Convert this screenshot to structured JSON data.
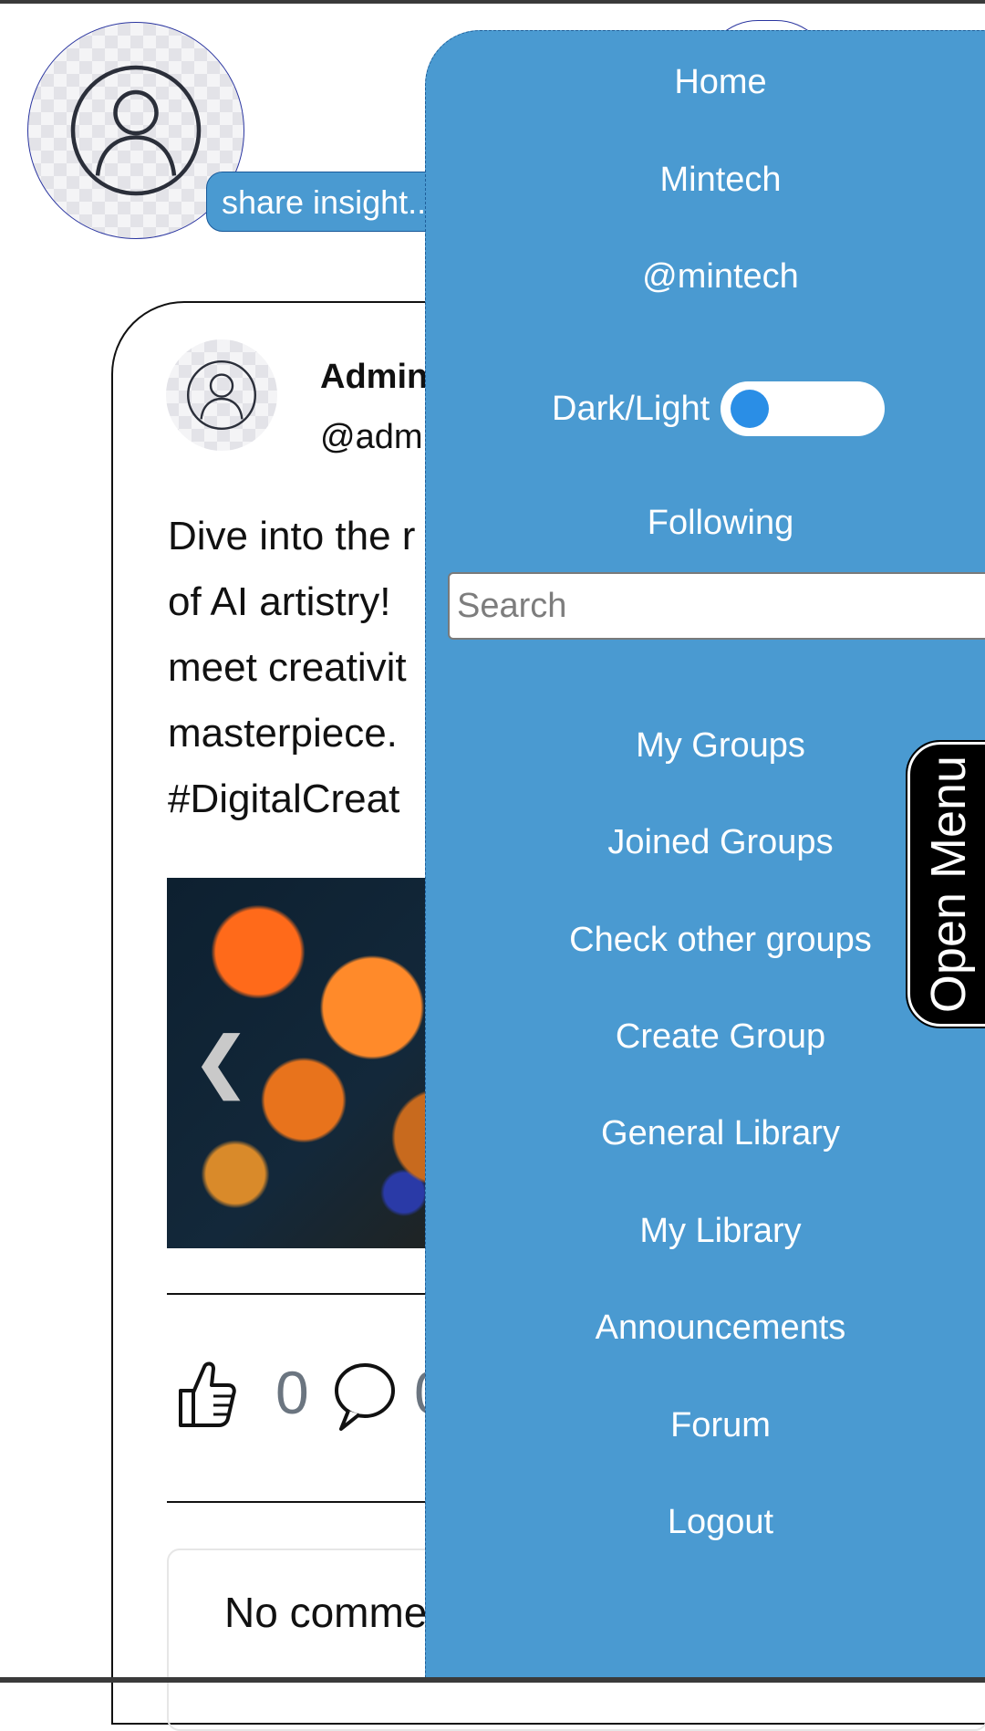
{
  "composer": {
    "placeholder": "share insight..."
  },
  "post": {
    "author_name": "Admin",
    "author_handle": "@admin",
    "text": "Dive into the r\nof AI artistry!\nmeet creativit\nmasterpiece.\n#DigitalCreat",
    "like_count": "0",
    "comment_count": "0",
    "comments_empty": "No comme"
  },
  "menu": {
    "home": "Home",
    "profile_name": "Mintech",
    "profile_handle": "@mintech",
    "theme_toggle_label": "Dark/Light",
    "following": "Following",
    "search_placeholder": "Search",
    "items": [
      "My Groups",
      "Joined Groups",
      "Check other groups",
      "Create Group",
      "General Library",
      "My Library",
      "Announcements",
      "Forum",
      "Logout"
    ]
  },
  "open_menu_label": "Open Menu",
  "colors": {
    "menu_bg": "#4a9ad1",
    "toggle_knob": "#2a8ee6",
    "count_gray": "#6b7580"
  },
  "icons": {
    "avatar": "user-avatar-icon",
    "like": "thumbs-up-icon",
    "comment": "speech-bubble-icon",
    "prev": "chevron-left-icon"
  }
}
